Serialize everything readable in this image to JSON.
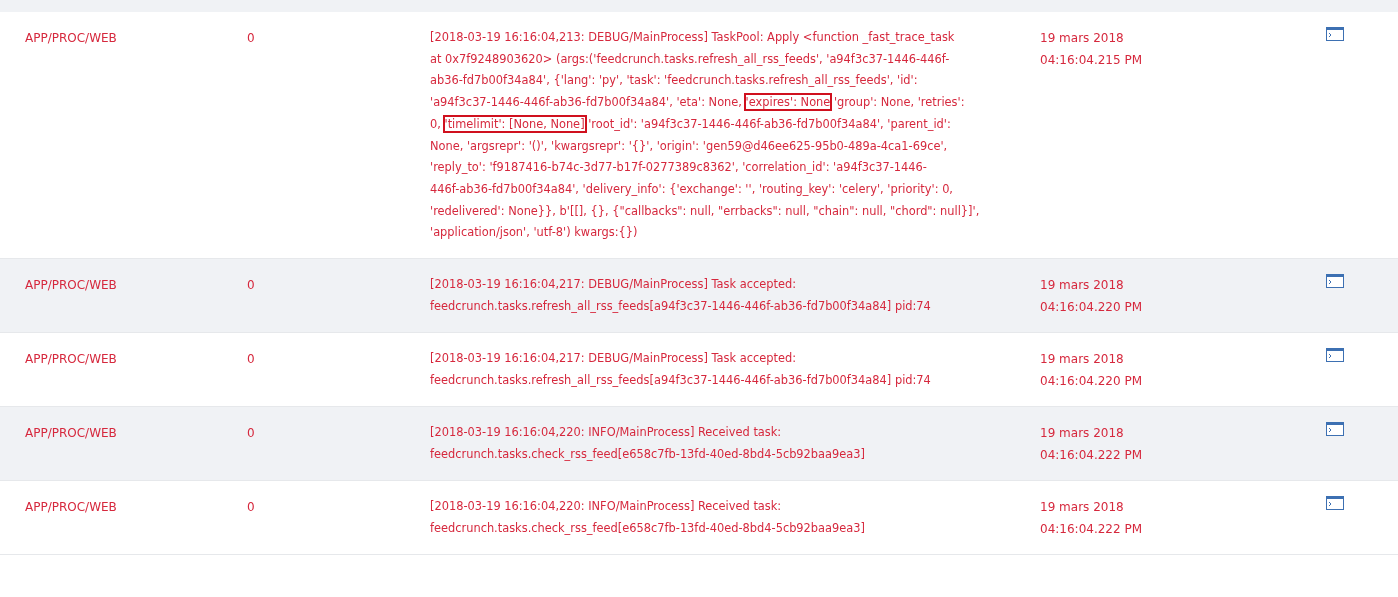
{
  "rows": [
    {
      "source": "APP/PROC/WEB",
      "instance": "0",
      "message_lines": [
        [
          {
            "text": "[2018-03-19 16:16:04,213: DEBUG/MainProcess] TaskPool: Apply <function _fast_trace_task",
            "highlighted": false
          }
        ],
        [
          {
            "text": "at 0x7f9248903620> (args:('feedcrunch.tasks.refresh_all_rss_feeds', 'a94f3c37-1446-446f-",
            "highlighted": false
          }
        ],
        [
          {
            "text": "ab36-fd7b00f34a84', {'lang': 'py', 'task': 'feedcrunch.tasks.refresh_all_rss_feeds', 'id':",
            "highlighted": false
          }
        ],
        [
          {
            "text": "'a94f3c37-1446-446f-ab36-fd7b00f34a84', 'eta': None, ",
            "highlighted": false
          },
          {
            "text": "'expires': None",
            "highlighted": true
          },
          {
            "text": " 'group': None, 'retries':",
            "highlighted": false
          }
        ],
        [
          {
            "text": "0, ",
            "highlighted": false
          },
          {
            "text": "'timelimit': [None, None]",
            "highlighted": true
          },
          {
            "text": " 'root_id': 'a94f3c37-1446-446f-ab36-fd7b00f34a84', 'parent_id':",
            "highlighted": false
          }
        ],
        [
          {
            "text": "None, 'argsrepr': '()', 'kwargsrepr': '{}', 'origin': 'gen59@d46ee625-95b0-489a-4ca1-69ce',",
            "highlighted": false
          }
        ],
        [
          {
            "text": "'reply_to': 'f9187416-b74c-3d77-b17f-0277389c8362', 'correlation_id': 'a94f3c37-1446-",
            "highlighted": false
          }
        ],
        [
          {
            "text": "446f-ab36-fd7b00f34a84', 'delivery_info': {'exchange': '', 'routing_key': 'celery', 'priority': 0,",
            "highlighted": false
          }
        ],
        [
          {
            "text": "'redelivered': None}}, b'[[], {}, {\"callbacks\": null, \"errbacks\": null, \"chain\": null, \"chord\": null}]',",
            "highlighted": false
          }
        ],
        [
          {
            "text": "'application/json', 'utf-8') kwargs:{})",
            "highlighted": false
          }
        ]
      ],
      "date": "19 mars 2018",
      "time": "04:16:04.215 PM"
    },
    {
      "source": "APP/PROC/WEB",
      "instance": "0",
      "message_lines": [
        [
          {
            "text": "[2018-03-19 16:16:04,217: DEBUG/MainProcess] Task accepted:",
            "highlighted": false
          }
        ],
        [
          {
            "text": "feedcrunch.tasks.refresh_all_rss_feeds[a94f3c37-1446-446f-ab36-fd7b00f34a84] pid:74",
            "highlighted": false
          }
        ]
      ],
      "date": "19 mars 2018",
      "time": "04:16:04.220 PM"
    },
    {
      "source": "APP/PROC/WEB",
      "instance": "0",
      "message_lines": [
        [
          {
            "text": "[2018-03-19 16:16:04,217: DEBUG/MainProcess] Task accepted:",
            "highlighted": false
          }
        ],
        [
          {
            "text": "feedcrunch.tasks.refresh_all_rss_feeds[a94f3c37-1446-446f-ab36-fd7b00f34a84] pid:74",
            "highlighted": false
          }
        ]
      ],
      "date": "19 mars 2018",
      "time": "04:16:04.220 PM"
    },
    {
      "source": "APP/PROC/WEB",
      "instance": "0",
      "message_lines": [
        [
          {
            "text": "[2018-03-19 16:16:04,220: INFO/MainProcess] Received task:",
            "highlighted": false
          }
        ],
        [
          {
            "text": "feedcrunch.tasks.check_rss_feed[e658c7fb-13fd-40ed-8bd4-5cb92baa9ea3]",
            "highlighted": false
          }
        ]
      ],
      "date": "19 mars 2018",
      "time": "04:16:04.222 PM"
    },
    {
      "source": "APP/PROC/WEB",
      "instance": "0",
      "message_lines": [
        [
          {
            "text": "[2018-03-19 16:16:04,220: INFO/MainProcess] Received task:",
            "highlighted": false
          }
        ],
        [
          {
            "text": "feedcrunch.tasks.check_rss_feed[e658c7fb-13fd-40ed-8bd4-5cb92baa9ea3]",
            "highlighted": false
          }
        ]
      ],
      "date": "19 mars 2018",
      "time": "04:16:04.222 PM"
    }
  ]
}
